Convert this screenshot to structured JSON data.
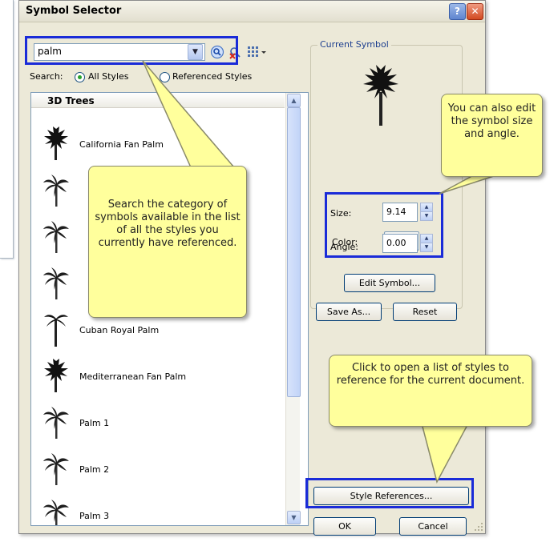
{
  "dialog": {
    "title": "Symbol Selector",
    "help_label": "?",
    "close_label": "✕"
  },
  "search": {
    "value": "palm",
    "search_label": "Search:",
    "radio_all_label": "All Styles",
    "radio_referenced_label": "Referenced Styles",
    "selected_scope": "All Styles"
  },
  "list": {
    "header": "3D Trees",
    "items": [
      {
        "label": "California Fan Palm",
        "icon": "fan-palm-icon"
      },
      {
        "label": "",
        "icon": "palm-icon"
      },
      {
        "label": "",
        "icon": "palm-icon"
      },
      {
        "label": "",
        "icon": "palm-icon"
      },
      {
        "label": "Cuban Royal Palm",
        "icon": "royal-palm-icon"
      },
      {
        "label": "Mediterranean Fan Palm",
        "icon": "fan-palm-icon"
      },
      {
        "label": "Palm 1",
        "icon": "palm-icon"
      },
      {
        "label": "Palm 2",
        "icon": "palm-icon"
      },
      {
        "label": "Palm 3",
        "icon": "palm-icon"
      }
    ]
  },
  "current_symbol": {
    "legend": "Current Symbol",
    "color_label": "Color:",
    "size_label": "Size:",
    "size_value": "9.14",
    "angle_label": "Angle:",
    "angle_value": "0.00",
    "edit_symbol_label": "Edit Symbol...",
    "save_as_label": "Save As...",
    "reset_label": "Reset"
  },
  "footer": {
    "style_references_label": "Style References...",
    "ok_label": "OK",
    "cancel_label": "Cancel"
  },
  "callouts": {
    "search": "Search the category of symbols available in the list of all the styles you currently have referenced.",
    "size": "You can also edit the symbol size and angle.",
    "style": "Click to open a list of styles to reference for the current document."
  },
  "colors": {
    "highlight": "#1a2bd8",
    "callout_fill": "#ffff9c",
    "dialog_bg": "#ece9d8"
  }
}
